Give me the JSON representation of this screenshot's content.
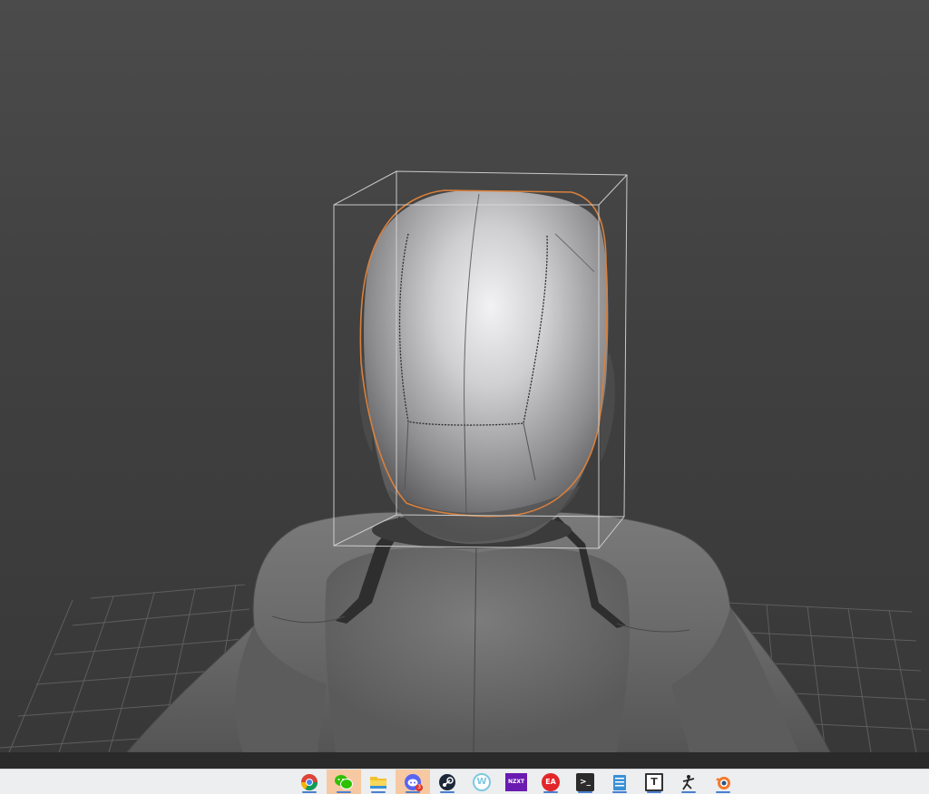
{
  "viewport": {
    "object_name": "helmet",
    "background_top": "#4b4b4b",
    "background_bottom": "#383838",
    "selection_outline_color": "#d9803c",
    "bounding_box_color": "#d8d8d8",
    "grid_color": "#5e5e5e"
  },
  "taskbar": {
    "items": [
      {
        "name": "chrome-icon",
        "label": "",
        "color": "#4285f4",
        "active": true
      },
      {
        "name": "wechat-icon",
        "label": "",
        "color": "#2dc100",
        "active": true,
        "highlight": true
      },
      {
        "name": "file-explorer-icon",
        "label": "",
        "color": "#f2c12e",
        "active": true
      },
      {
        "name": "discord-icon",
        "label": "",
        "color": "#5865f2",
        "active": true,
        "highlight": true,
        "badge": "3"
      },
      {
        "name": "steam-icon",
        "label": "",
        "color": "#1b2838",
        "active": true
      },
      {
        "name": "wps-icon",
        "label": "W",
        "color": "#7ec8e3",
        "active": false
      },
      {
        "name": "nzxt-icon",
        "label": "NZXT",
        "color": "#6a1bb0",
        "active": false
      },
      {
        "name": "ea-icon",
        "label": "EA",
        "color": "#e3262b",
        "active": true
      },
      {
        "name": "terminal-icon",
        "label": ">_",
        "color": "#2b2b2b",
        "active": true
      },
      {
        "name": "notepad-icon",
        "label": "",
        "color": "#3a8fd6",
        "active": true
      },
      {
        "name": "typora-icon",
        "label": "T",
        "color": "#333333",
        "active": true
      },
      {
        "name": "zbrush-icon",
        "label": "",
        "color": "#e9e9e9",
        "active": true
      },
      {
        "name": "blender-icon",
        "label": "",
        "color": "#f5792a",
        "active": true
      }
    ]
  }
}
